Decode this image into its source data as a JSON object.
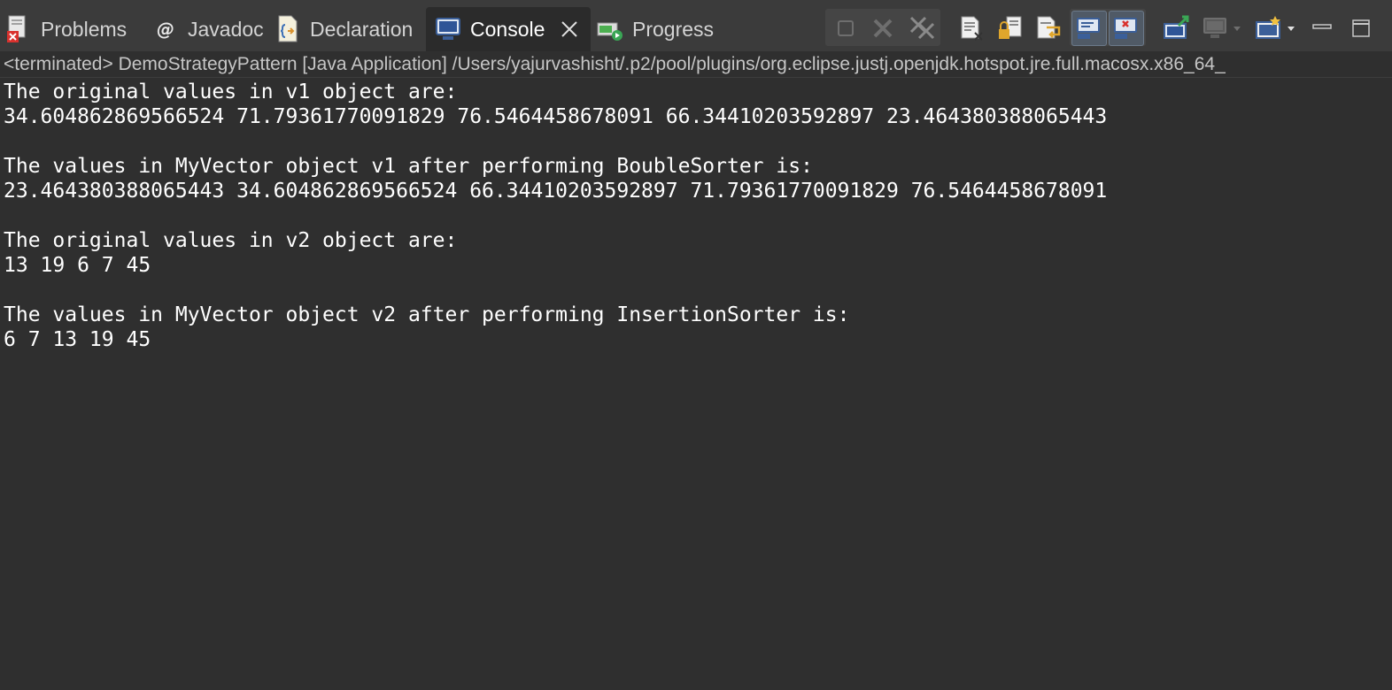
{
  "tabs": [
    {
      "label": "Problems",
      "icon": "problems-icon",
      "active": false
    },
    {
      "label": "Javadoc",
      "icon": "javadoc-icon",
      "active": false
    },
    {
      "label": "Declaration",
      "icon": "declaration-icon",
      "active": false
    },
    {
      "label": "Console",
      "icon": "console-icon",
      "active": true
    },
    {
      "label": "Progress",
      "icon": "progress-icon",
      "active": false
    }
  ],
  "toolbar": {
    "buttons": [
      "terminate-icon",
      "remove-launch-icon",
      "remove-all-terminated-icon",
      "clear-console-icon",
      "scroll-lock-icon",
      "word-wrap-icon",
      "show-on-stdout-icon",
      "show-on-stderr-icon",
      "pin-console-icon",
      "display-selected-console-icon",
      "open-console-icon",
      "minimize-icon",
      "maximize-icon"
    ]
  },
  "status": {
    "text": "<terminated> DemoStrategyPattern [Java Application] /Users/yajurvashisht/.p2/pool/plugins/org.eclipse.justj.openjdk.hotspot.jre.full.macosx.x86_64_"
  },
  "console": {
    "lines": [
      "The original values in v1 object are:",
      "34.604862869566524 71.79361770091829 76.5464458678091 66.34410203592897 23.464380388065443",
      "",
      "The values in MyVector object v1 after performing BoubleSorter is:",
      "23.464380388065443 34.604862869566524 66.34410203592897 71.79361770091829 76.5464458678091",
      "",
      "The original values in v2 object are:",
      "13 19 6 7 45",
      "",
      "The values in MyVector object v2 after performing InsertionSorter is:",
      "6 7 13 19 45"
    ]
  },
  "colors": {
    "background": "#2f2f2f",
    "tabbar": "#3b3b3b",
    "text": "#ffffff",
    "accent": "#4a90d9"
  }
}
